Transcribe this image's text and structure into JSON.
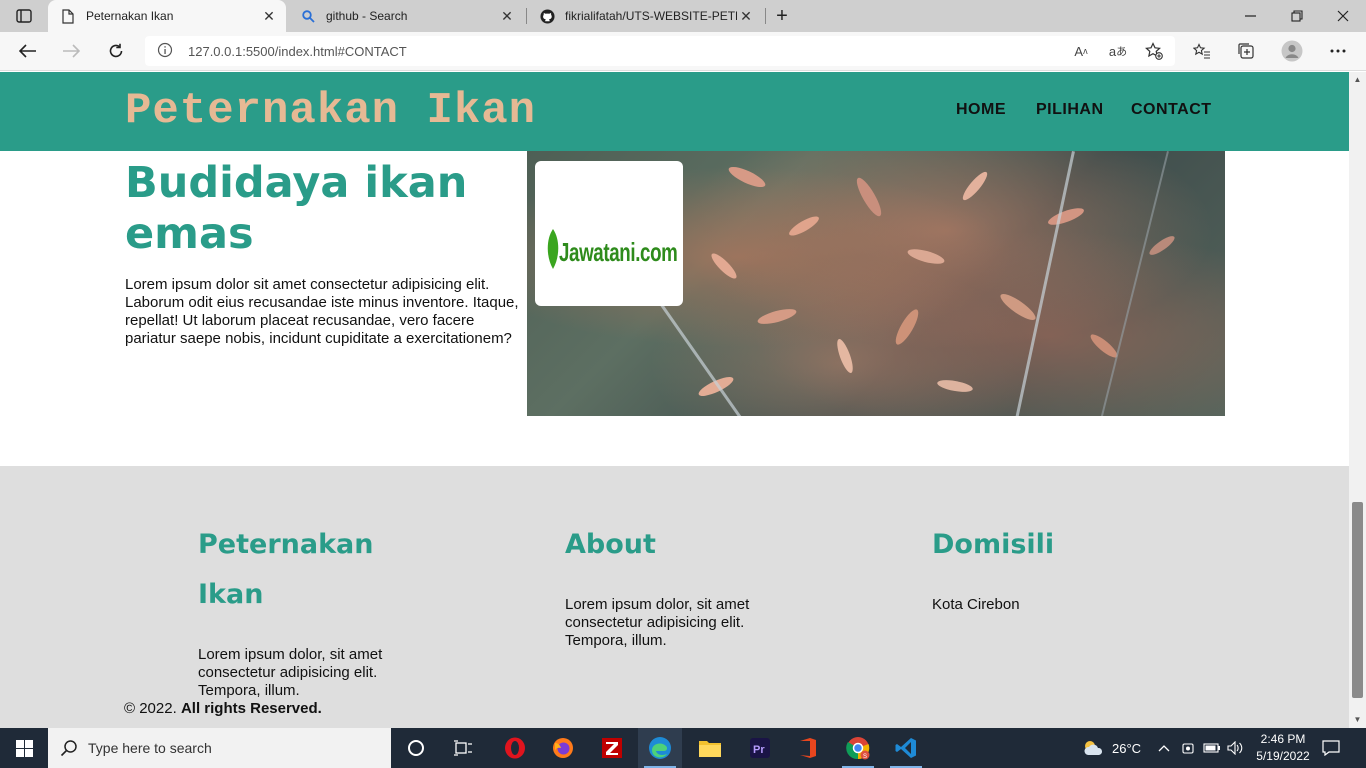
{
  "browser": {
    "tabs": [
      {
        "title": "Peternakan Ikan",
        "active": true
      },
      {
        "title": "github - Search",
        "active": false
      },
      {
        "title": "fikrialifatah/UTS-WEBSITE-PETER",
        "active": false
      }
    ],
    "address": {
      "url": "127.0.0.1:5500/index.html#CONTACT"
    }
  },
  "site": {
    "brand": "Peternakan Ikan",
    "nav": [
      "HOME",
      "PILIHAN",
      "CONTACT"
    ],
    "hero": {
      "title": "Budidaya ikan emas",
      "text": "Lorem ipsum dolor sit amet consectetur adipisicing elit. Laborum odit eius recusandae iste minus inventore. Itaque, repellat! Ut laborum placeat recusandae, vero facere pariatur saepe nobis, incidunt cupiditate a exercitationem?",
      "image_watermark": "Jawatani.com"
    },
    "footer": {
      "columns": [
        {
          "title": "Peternakan Ikan",
          "text": "Lorem ipsum dolor, sit amet consectetur adipisicing elit. Tempora, illum."
        },
        {
          "title": "About",
          "text": "Lorem ipsum dolor, sit amet consectetur adipisicing elit. Tempora, illum."
        },
        {
          "title": "Domisili",
          "text": "Kota Cirebon"
        }
      ],
      "copyright_prefix": "© 2022.",
      "copyright_bold": "All rights Reserved."
    },
    "colors": {
      "header": "#2a9c89",
      "brand": "#e6b994",
      "footer_bg": "#dedede"
    }
  },
  "taskbar": {
    "search_placeholder": "Type here to search",
    "weather": "26°C",
    "time": "2:46 PM",
    "date": "5/19/2022",
    "apps": [
      "task-view-icon",
      "opera-icon",
      "firefox-icon",
      "filezilla-icon",
      "edge-icon",
      "file-explorer-icon",
      "premiere-icon",
      "office-icon",
      "chrome-icon",
      "vscode-icon"
    ]
  }
}
